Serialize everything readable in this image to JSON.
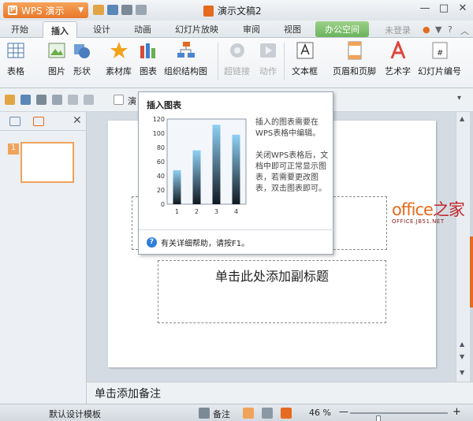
{
  "app": {
    "name": "WPS 演示",
    "doc_title": "演示文稿2"
  },
  "tabs": [
    {
      "label": "开始"
    },
    {
      "label": "插入"
    },
    {
      "label": "设计"
    },
    {
      "label": "动画"
    },
    {
      "label": "幻灯片放映"
    },
    {
      "label": "审阅"
    },
    {
      "label": "视图"
    },
    {
      "label": "办公空间"
    }
  ],
  "account": {
    "login": "未登录"
  },
  "ribbon": {
    "items": [
      {
        "label": "表格",
        "icon": "table-icon"
      },
      {
        "label": "图片",
        "icon": "picture-icon"
      },
      {
        "label": "形状",
        "icon": "shape-icon"
      },
      {
        "label": "素材库",
        "icon": "star-icon"
      },
      {
        "label": "图表",
        "icon": "bar-chart-icon"
      },
      {
        "label": "组织结构图",
        "icon": "org-chart-icon"
      },
      {
        "label": "超链接",
        "icon": "hyperlink-icon"
      },
      {
        "label": "动作",
        "icon": "action-icon"
      },
      {
        "label": "文本框",
        "icon": "textbox-icon"
      },
      {
        "label": "页眉和页脚",
        "icon": "header-footer-icon"
      },
      {
        "label": "艺术字",
        "icon": "wordart-icon"
      },
      {
        "label": "幻灯片编号",
        "icon": "slide-number-icon"
      }
    ]
  },
  "toolbar": {
    "doc_tab_label": "演"
  },
  "panel": {
    "slide_number": "1"
  },
  "slide": {
    "subtitle_placeholder": "单击此处添加副标题"
  },
  "notes": {
    "placeholder": "单击添加备注"
  },
  "status": {
    "template": "默认设计模板",
    "notes_label": "备注",
    "zoom": "46 %",
    "zoom_value": 46
  },
  "tooltip": {
    "title": "插入图表",
    "desc1": "插入的图表需要在WPS表格中编辑。",
    "desc2": "关闭WPS表格后，文档中即可正常显示图表，若需要更改图表，双击图表即可。",
    "help": "有关详细帮助，请按F1。"
  },
  "chart_data": {
    "type": "bar",
    "categories": [
      "1",
      "2",
      "3",
      "4"
    ],
    "values": [
      48,
      76,
      112,
      98
    ],
    "ylim": [
      0,
      120
    ],
    "yticks": [
      0,
      20,
      40,
      60,
      80,
      100,
      120
    ],
    "grid": false,
    "legend": "none"
  },
  "watermark": {
    "brand_a": "office",
    "brand_b": "之家",
    "url": "OFFICE.JB51.NET"
  },
  "colors": {
    "accent": "#e46b1f",
    "highlight": "#e02020",
    "bar_top": "#8fd0f4",
    "bar_bottom": "#101820"
  }
}
